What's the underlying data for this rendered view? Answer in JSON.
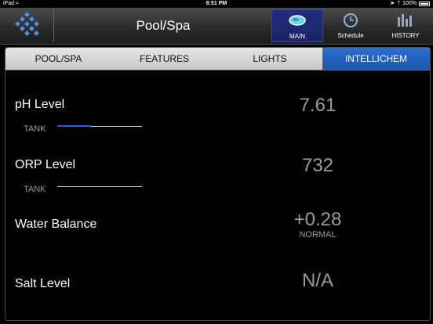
{
  "status_bar": {
    "device": "iPad",
    "time": "6:51 PM",
    "battery": "100%"
  },
  "header": {
    "title": "Pool/Spa",
    "buttons": {
      "main": "MAIN",
      "schedule": "Schedule",
      "history": "HISTORY"
    }
  },
  "tabs": [
    "POOL/SPA",
    "FEATURES",
    "LIGHTS",
    "INTELLICHEM"
  ],
  "active_tab": "INTELLICHEM",
  "rows": {
    "ph": {
      "label": "pH Level",
      "value": "7.61",
      "tank_label": "TANK",
      "tank_fill": 0.4
    },
    "orp": {
      "label": "ORP Level",
      "value": "732",
      "tank_label": "TANK",
      "tank_fill": 0.0
    },
    "balance": {
      "label": "Water Balance",
      "value": "+0.28",
      "status": "NORMAL"
    },
    "salt": {
      "label": "Salt Level",
      "value": "N/A"
    }
  },
  "colors": {
    "accent": "#1f2c7c",
    "active_tab": "#2b6fd1",
    "tank_fill": "#2a5fc4"
  }
}
